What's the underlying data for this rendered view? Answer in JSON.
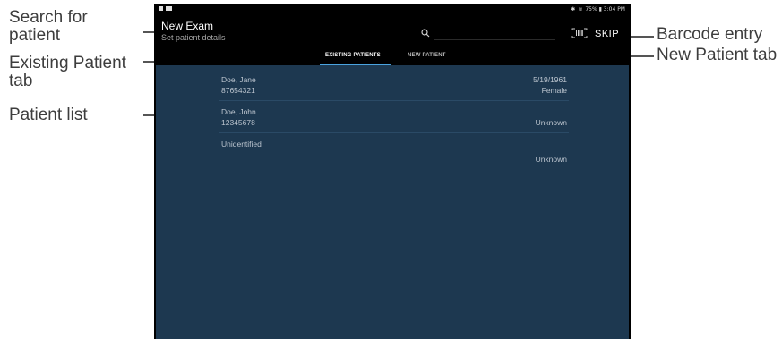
{
  "annotations": {
    "search": "Search for\npatient",
    "existing_tab": "Existing Patient\ntab",
    "patient_list": "Patient list",
    "barcode": "Barcode entry",
    "new_tab": "New Patient tab"
  },
  "status_bar": {
    "right_text": "75% ▮ 3:04 PM",
    "left_icons": [
      "sim-icon",
      "image-icon"
    ]
  },
  "app": {
    "title": "New Exam",
    "subtitle": "Set patient details",
    "skip_label": "SKIP",
    "search_icon": "search-icon",
    "barcode_icon": "barcode-scan-icon"
  },
  "tabs": [
    {
      "label": "EXISTING PATIENTS",
      "active": true
    },
    {
      "label": "NEW PATIENT",
      "active": false
    }
  ],
  "patients": [
    {
      "name": "Doe, Jane",
      "id": "87654321",
      "dob": "5/19/1961",
      "sex": "Female"
    },
    {
      "name": "Doe, John",
      "id": "12345678",
      "dob": "",
      "sex": "Unknown"
    },
    {
      "name": "Unidentified",
      "id": "",
      "dob": "",
      "sex": "Unknown"
    }
  ],
  "colors": {
    "list_background": "#1d3850",
    "tab_indicator": "#4aa3df",
    "screen_background": "#000000"
  }
}
